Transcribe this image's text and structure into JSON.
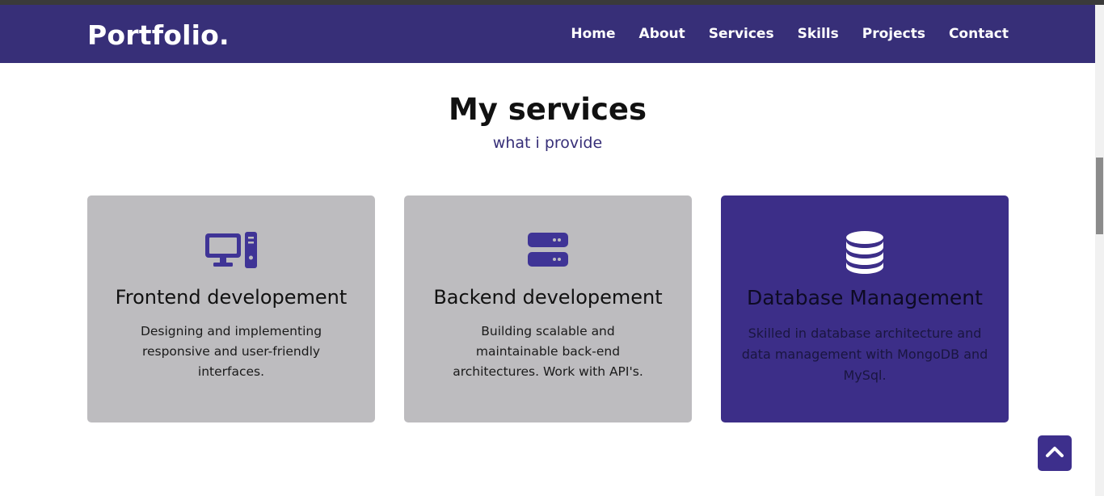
{
  "header": {
    "brand": "Portfolio.",
    "nav": [
      "Home",
      "About",
      "Services",
      "Skills",
      "Projects",
      "Contact"
    ]
  },
  "services": {
    "title": "My services",
    "subtitle": "what i provide",
    "cards": [
      {
        "icon": "desktop-computer-icon",
        "title": "Frontend developement",
        "text": "Designing and implementing responsive and user-friendly interfaces."
      },
      {
        "icon": "server-icon",
        "title": "Backend developement",
        "text": "Building scalable and maintainable back-end architectures. Work with API's."
      },
      {
        "icon": "database-icon",
        "title": "Database Management",
        "text": "Skilled in database architecture and data management with MongoDB and MySql."
      }
    ]
  },
  "scroll_top": {
    "icon": "chevron-up-icon"
  },
  "colors": {
    "nav_bg": "#372f78",
    "accent": "#3c2e88",
    "card_bg": "#bdbcbf",
    "icon_color": "#3f3496"
  }
}
